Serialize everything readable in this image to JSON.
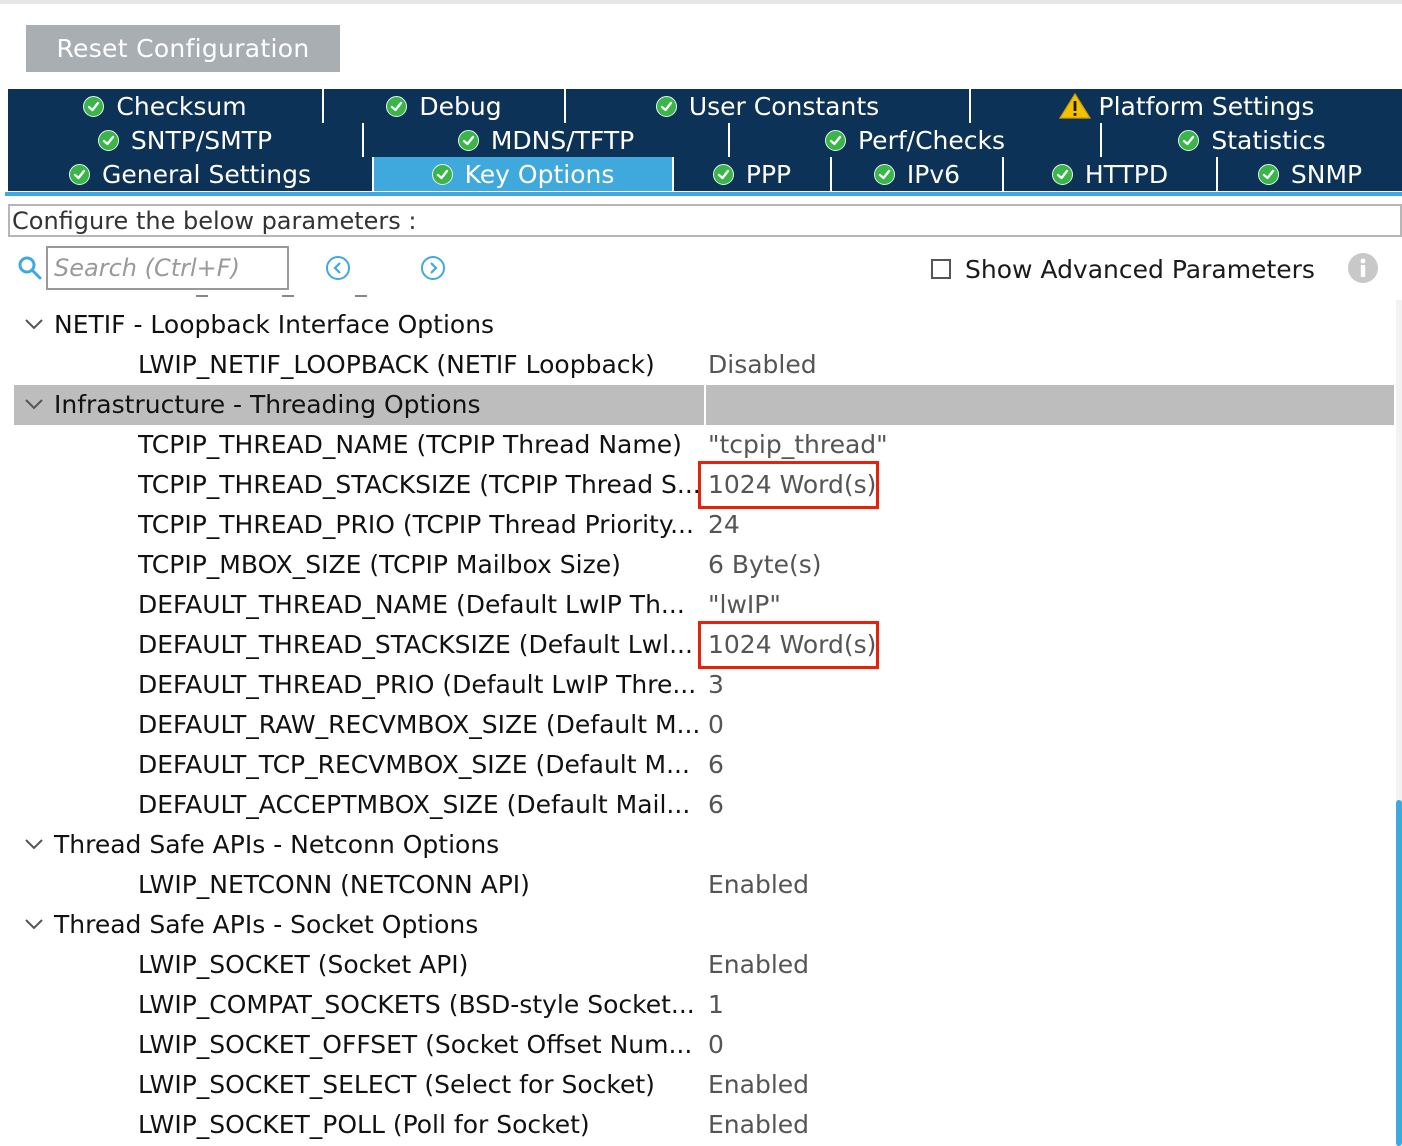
{
  "toolbar": {
    "reset_label": "Reset Configuration"
  },
  "tabs": {
    "row1": [
      {
        "label": "Checksum",
        "status": "ok"
      },
      {
        "label": "Debug",
        "status": "ok"
      },
      {
        "label": "User Constants",
        "status": "ok"
      },
      {
        "label": "Platform Settings",
        "status": "warning"
      }
    ],
    "row2": [
      {
        "label": "SNTP/SMTP",
        "status": "ok"
      },
      {
        "label": "MDNS/TFTP",
        "status": "ok"
      },
      {
        "label": "Perf/Checks",
        "status": "ok"
      },
      {
        "label": "Statistics",
        "status": "ok"
      }
    ],
    "row3": [
      {
        "label": "General Settings",
        "status": "ok"
      },
      {
        "label": "Key Options",
        "status": "ok",
        "active": true
      },
      {
        "label": "PPP",
        "status": "ok"
      },
      {
        "label": "IPv6",
        "status": "ok"
      },
      {
        "label": "HTTPD",
        "status": "ok"
      },
      {
        "label": "SNMP",
        "status": "ok"
      }
    ]
  },
  "description": "Configure the below parameters :",
  "search": {
    "placeholder": "Search (Ctrl+F)"
  },
  "advanced": {
    "label": "Show Advanced Parameters",
    "checked": false
  },
  "tree": {
    "groups": [
      {
        "title": "NETIF - Loopback Interface Options",
        "expanded": true,
        "params": [
          {
            "name": "LWIP_NETIF_LOOPBACK (NETIF Loopback)",
            "value": "Disabled"
          }
        ]
      },
      {
        "title": "Infrastructure - Threading Options",
        "expanded": true,
        "selected": true,
        "params": [
          {
            "name": "TCPIP_THREAD_NAME (TCPIP Thread Name)",
            "value": "\"tcpip_thread\""
          },
          {
            "name": "TCPIP_THREAD_STACKSIZE (TCPIP Thread S...",
            "value": "1024 Word(s)",
            "highlighted": true
          },
          {
            "name": "TCPIP_THREAD_PRIO (TCPIP Thread Priority...",
            "value": "24"
          },
          {
            "name": "TCPIP_MBOX_SIZE (TCPIP Mailbox Size)",
            "value": "6 Byte(s)"
          },
          {
            "name": "DEFAULT_THREAD_NAME (Default LwIP Th...",
            "value": "\"lwIP\""
          },
          {
            "name": "DEFAULT_THREAD_STACKSIZE (Default Lwl...",
            "value": "1024 Word(s)",
            "highlighted": true
          },
          {
            "name": "DEFAULT_THREAD_PRIO (Default LwIP Thre...",
            "value": "3"
          },
          {
            "name": "DEFAULT_RAW_RECVMBOX_SIZE (Default M...",
            "value": "0"
          },
          {
            "name": "DEFAULT_TCP_RECVMBOX_SIZE (Default M...",
            "value": "6"
          },
          {
            "name": "DEFAULT_ACCEPTMBOX_SIZE (Default Mail...",
            "value": "6"
          }
        ]
      },
      {
        "title": "Thread Safe APIs - Netconn Options",
        "expanded": true,
        "params": [
          {
            "name": "LWIP_NETCONN (NETCONN API)",
            "value": "Enabled"
          }
        ]
      },
      {
        "title": "Thread Safe APIs - Socket Options",
        "expanded": true,
        "params": [
          {
            "name": "LWIP_SOCKET (Socket API)",
            "value": "Enabled"
          },
          {
            "name": "LWIP_COMPAT_SOCKETS (BSD-style Socket...",
            "value": "1"
          },
          {
            "name": "LWIP_SOCKET_OFFSET (Socket Offset Num...",
            "value": "0"
          },
          {
            "name": "LWIP_SOCKET_SELECT (Select for Socket)",
            "value": "Enabled"
          },
          {
            "name": "LWIP_SOCKET_POLL (Poll for Socket)",
            "value": "Enabled"
          }
        ]
      }
    ]
  },
  "colors": {
    "tab_bg": "#0d3258",
    "tab_active": "#3fa9dd",
    "ok_green": "#3ab54a",
    "warn_yellow": "#f2c200",
    "highlight_red": "#e8210b",
    "selected_row": "#bdbdbd"
  }
}
